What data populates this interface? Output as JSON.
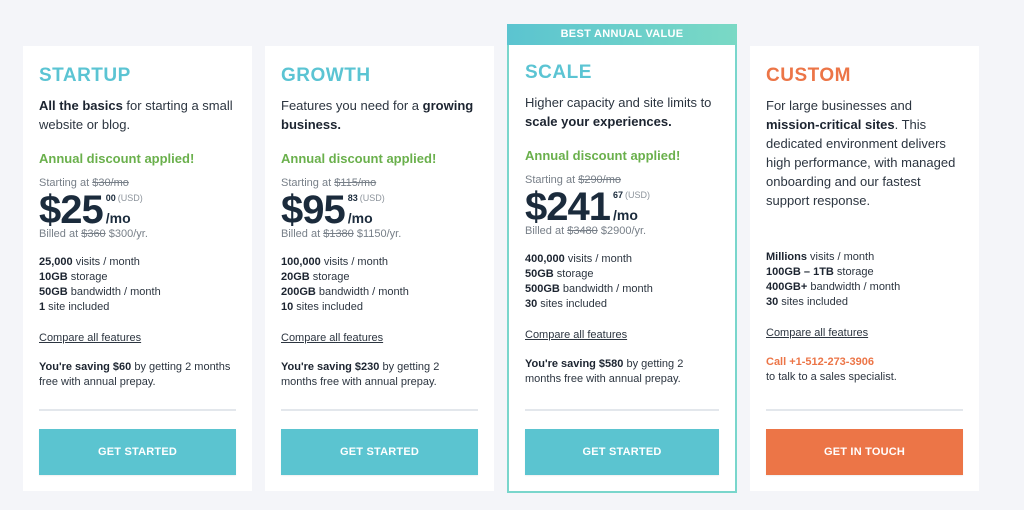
{
  "colors": {
    "teal": "#5bc4d0",
    "orange": "#ec7547",
    "green": "#6ab04c",
    "navy": "#1b2b3c",
    "background": "#f4f5f9"
  },
  "plans": [
    {
      "name": "STARTUP",
      "desc_bold": "All the basics",
      "desc_rest": " for starting a small website or blog.",
      "discount": "Annual discount applied!",
      "starting_label": "Starting at ",
      "starting_old": "$30/mo",
      "price": "$25",
      "cents": "00",
      "currency": "(USD)",
      "per": "/mo",
      "billed_label": "Billed at ",
      "billed_old": "$360",
      "billed_new": " $300/yr.",
      "features": [
        {
          "bold": "25,000",
          "text": " visits / month"
        },
        {
          "bold": "10GB",
          "text": " storage"
        },
        {
          "bold": "50GB",
          "text": " bandwidth / month"
        },
        {
          "bold": "1",
          "text": " site included"
        }
      ],
      "compare": "Compare all features",
      "saving_bold": "You're saving $60",
      "saving_rest": " by getting 2 months free with annual prepay.",
      "cta": "GET STARTED"
    },
    {
      "name": "GROWTH",
      "desc_pre": "Features you need for a ",
      "desc_bold": "growing business.",
      "discount": "Annual discount applied!",
      "starting_label": "Starting at ",
      "starting_old": "$115/mo",
      "price": "$95",
      "cents": "83",
      "currency": "(USD)",
      "per": "/mo",
      "billed_label": "Billed at ",
      "billed_old": "$1380",
      "billed_new": " $1150/yr.",
      "features": [
        {
          "bold": "100,000",
          "text": " visits / month"
        },
        {
          "bold": "20GB",
          "text": " storage"
        },
        {
          "bold": "200GB",
          "text": " bandwidth / month"
        },
        {
          "bold": "10",
          "text": " sites included"
        }
      ],
      "compare": "Compare all features",
      "saving_bold": "You're saving $230",
      "saving_rest": " by getting 2 months free with annual prepay.",
      "cta": "GET STARTED"
    },
    {
      "badge": "BEST ANNUAL VALUE",
      "name": "SCALE",
      "desc_pre": "Higher capacity and site limits to ",
      "desc_bold": "scale your experiences.",
      "discount": "Annual discount applied!",
      "starting_label": "Starting at ",
      "starting_old": "$290/mo",
      "price": "$241",
      "cents": "67",
      "currency": "(USD)",
      "per": "/mo",
      "billed_label": "Billed at ",
      "billed_old": "$3480",
      "billed_new": " $2900/yr.",
      "features": [
        {
          "bold": "400,000",
          "text": " visits / month"
        },
        {
          "bold": "50GB",
          "text": " storage"
        },
        {
          "bold": "500GB",
          "text": " bandwidth / month"
        },
        {
          "bold": "30",
          "text": " sites included"
        }
      ],
      "compare": "Compare all features",
      "saving_bold": "You're saving $580",
      "saving_rest": " by getting 2 months free with annual prepay.",
      "cta": "GET STARTED"
    },
    {
      "name": "CUSTOM",
      "desc_pre": "For large businesses and ",
      "desc_bold": "mission-critical sites",
      "desc_rest": ". This dedicated environment delivers high performance, with managed onboarding and our fastest support response.",
      "features": [
        {
          "bold": "Millions",
          "text": " visits / month"
        },
        {
          "bold": "100GB – 1TB",
          "text": " storage"
        },
        {
          "bold": "400GB+",
          "text": " bandwidth / month"
        },
        {
          "bold": "30",
          "text": " sites included"
        }
      ],
      "compare": "Compare all features",
      "call": "Call +1-512-273-3906",
      "call_rest": "to talk to a sales specialist.",
      "cta": "GET IN TOUCH"
    }
  ]
}
